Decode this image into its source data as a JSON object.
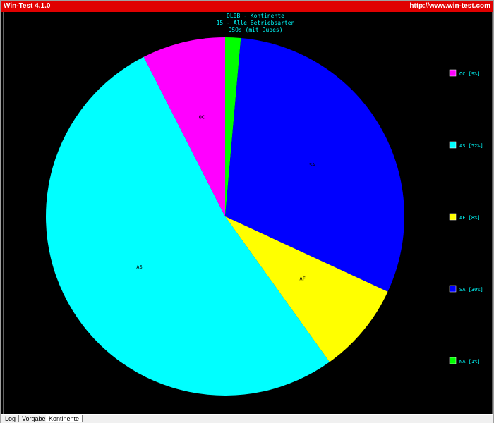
{
  "window": {
    "title": "Win-Test 4.1.0",
    "url": "http://www.win-test.com"
  },
  "tabs": [
    {
      "label": "Log"
    },
    {
      "label": "Vorgabe"
    },
    {
      "label": "Kontinente"
    }
  ],
  "chart_data": {
    "type": "pie",
    "title_lines": [
      "DL0B - Kontinente",
      "15 - Alle Betriebsarten",
      "QSOs (mit Dupes)"
    ],
    "slices": [
      {
        "name": "NA",
        "slice_label": "",
        "legend": "NA [1%]",
        "percent": 1.4,
        "color": "#00ff00"
      },
      {
        "name": "SA",
        "slice_label": "SA",
        "legend": "SA [30%]",
        "percent": 30.5,
        "color": "#0000ff"
      },
      {
        "name": "AF",
        "slice_label": "AF",
        "legend": "AF [8%]",
        "percent": 8.2,
        "color": "#ffff00"
      },
      {
        "name": "AS",
        "slice_label": "AS",
        "legend": "AS [52%]",
        "percent": 52.4,
        "color": "#00ffff"
      },
      {
        "name": "OC",
        "slice_label": "OC",
        "legend": "OC [9%]",
        "percent": 7.5,
        "color": "#ff00ff"
      }
    ],
    "legend_order": [
      "OC",
      "AS",
      "AF",
      "SA",
      "NA"
    ],
    "legend_placement": "right",
    "text_color": "#00ffff",
    "label_color": "#000000"
  }
}
